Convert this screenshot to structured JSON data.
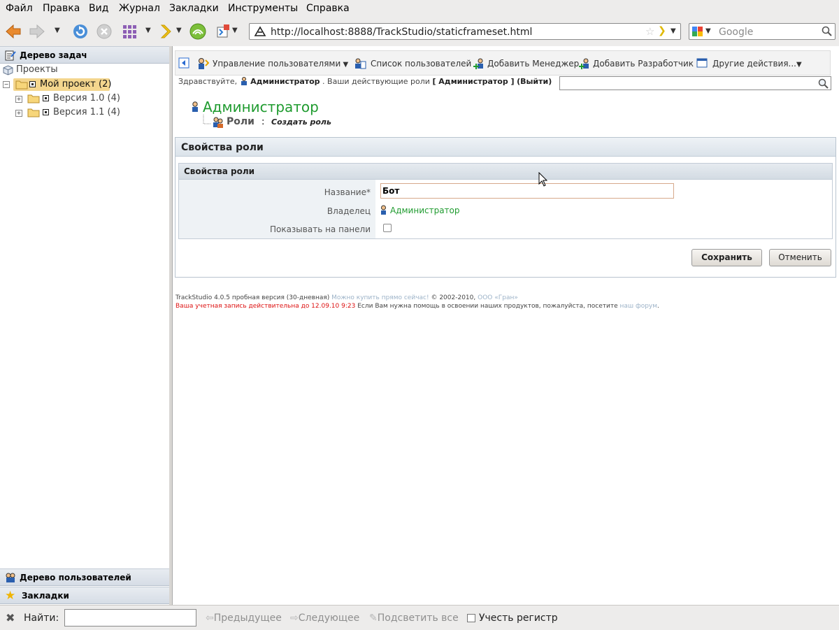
{
  "menu": [
    "Файл",
    "Правка",
    "Вид",
    "Журнал",
    "Закладки",
    "Инструменты",
    "Справка"
  ],
  "browser": {
    "url": "http://localhost:8888/TrackStudio/staticframeset.html",
    "search_placeholder": "Google"
  },
  "left": {
    "task_tree_title": "Дерево задач",
    "tree": {
      "root": "Проекты",
      "project": "Мой проект (2)",
      "versions": [
        "Версия 1.0 (4)",
        "Версия 1.1 (4)"
      ]
    },
    "user_tree_title": "Дерево пользователей",
    "bookmarks_title": "Закладки"
  },
  "toolbar": {
    "manage_users": "Управление пользователями",
    "user_list": "Список пользователей",
    "add_manager": "Добавить Менеджер",
    "add_developer": "Добавить Разработчик",
    "other_actions": "Другие действия..."
  },
  "greeting": {
    "hello": "Здравствуйте,",
    "user": "Администратор",
    "roles_text": ". Ваши действующие роли",
    "role": "[ Администратор ]",
    "logout": "(Выйти)"
  },
  "breadcrumb": {
    "title": "Администратор",
    "section": "Роли",
    "separator": ":",
    "action": "Создать роль"
  },
  "form": {
    "panel_title": "Свойства роли",
    "section_title": "Свойства роли",
    "name_label": "Название*",
    "name_value": "Бот",
    "owner_label": "Владелец",
    "owner_value": "Администратор",
    "show_label": "Показывать на панели",
    "show_checked": false,
    "save": "Сохранить",
    "cancel": "Отменить"
  },
  "footer": {
    "version": "TrackStudio 4.0.5 пробная версия (30-дневная)",
    "buy": "Можно купить прямо сейчас!",
    "copyright": "© 2002-2010,",
    "company": "ООО «Гран»",
    "valid": "Ваша учетная запись действительна до 12.09.10 9:23",
    "help": "Если Вам нужна помощь в освоении наших продуктов, пожалуйста, посетите",
    "forum": "наш форум",
    "dot": "."
  },
  "findbar": {
    "find_label": "Найти:",
    "prev": "Предыдущее",
    "next": "Следующее",
    "highlight": "Подсветить все",
    "match_case": "Учесть регистр"
  },
  "colors": {
    "accent_green": "#1f9b2f",
    "link_grey": "#9db3c8",
    "warning_red": "#dd1111"
  }
}
